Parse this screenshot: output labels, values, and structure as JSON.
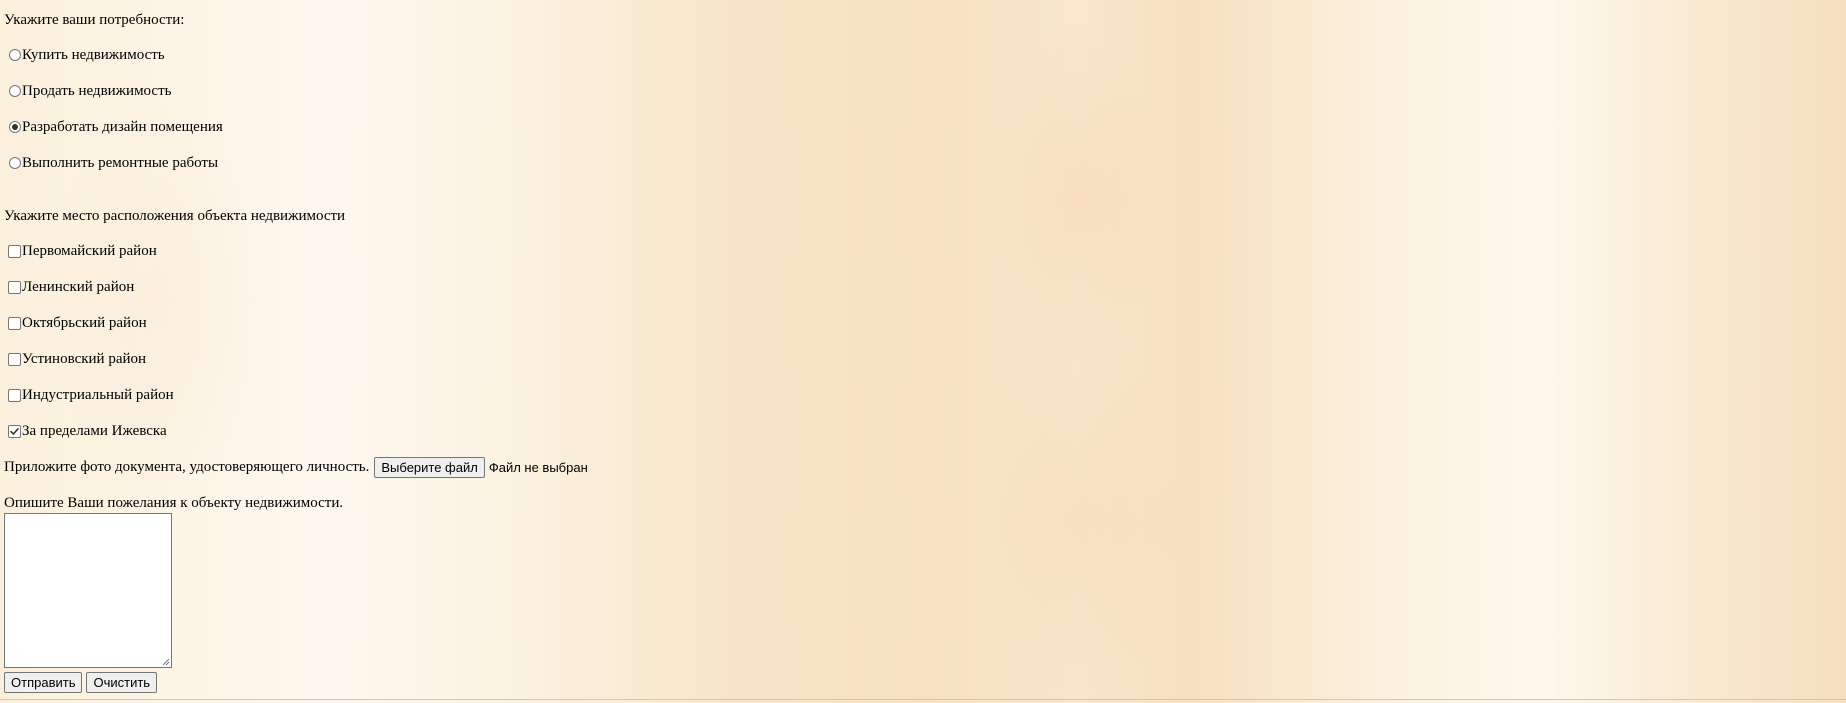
{
  "needs": {
    "heading": "Укажите ваши потребности:",
    "options": [
      {
        "label": "Купить недвижимость",
        "checked": false
      },
      {
        "label": "Продать недвижимость",
        "checked": false
      },
      {
        "label": "Разработать дизайн помещения",
        "checked": true
      },
      {
        "label": "Выполнить ремонтные работы",
        "checked": false
      }
    ]
  },
  "location": {
    "heading": "Укажите место расположения объекта недвижимости",
    "options": [
      {
        "label": "Первомайский район",
        "checked": false
      },
      {
        "label": "Ленинский район",
        "checked": false
      },
      {
        "label": "Октябрьский район",
        "checked": false
      },
      {
        "label": "Устиновский район",
        "checked": false
      },
      {
        "label": "Индустриальный район",
        "checked": false
      },
      {
        "label": "За пределами Ижевска",
        "checked": true
      }
    ]
  },
  "upload": {
    "label": "Приложите фото документа, удостоверяющего личность.",
    "button_label": "Выберите файл",
    "status": "Файл не выбран"
  },
  "wishes": {
    "label": "Опишите Ваши пожелания к объекту недвижимости.",
    "value": ""
  },
  "actions": {
    "submit_label": "Отправить",
    "reset_label": "Очистить"
  }
}
